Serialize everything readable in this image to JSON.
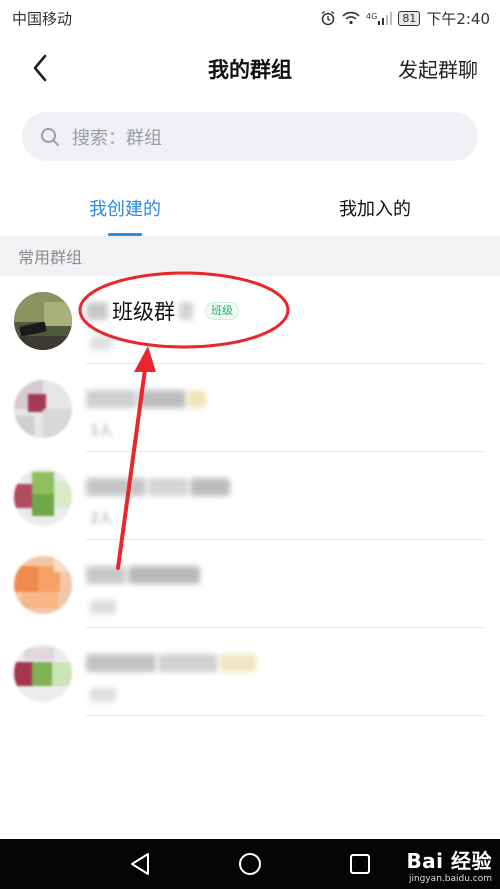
{
  "status_bar": {
    "carrier": "中国移动",
    "network_badge": "4G",
    "battery": "81",
    "time": "下午2:40"
  },
  "nav": {
    "title": "我的群组",
    "action": "发起群聊"
  },
  "search": {
    "placeholder": "搜索：群组"
  },
  "tabs": [
    {
      "label": "我创建的",
      "active": true
    },
    {
      "label": "我加入的",
      "active": false
    }
  ],
  "section": {
    "title": "常用群组"
  },
  "groups": [
    {
      "name": "班级群",
      "tag": "班级",
      "member_count": ""
    },
    {
      "name": "",
      "tag": "",
      "member_count": "1人"
    },
    {
      "name": "",
      "tag": "",
      "member_count": "2人"
    },
    {
      "name": "",
      "tag": "",
      "member_count": ""
    },
    {
      "name": "",
      "tag": "",
      "member_count": ""
    }
  ],
  "colors": {
    "accent": "#2a8be0",
    "annotation_red": "#e8262b",
    "tag_green": "#27b06b"
  },
  "watermark": {
    "brand": "Bai 经验",
    "url": "jingyan.baidu.com"
  }
}
